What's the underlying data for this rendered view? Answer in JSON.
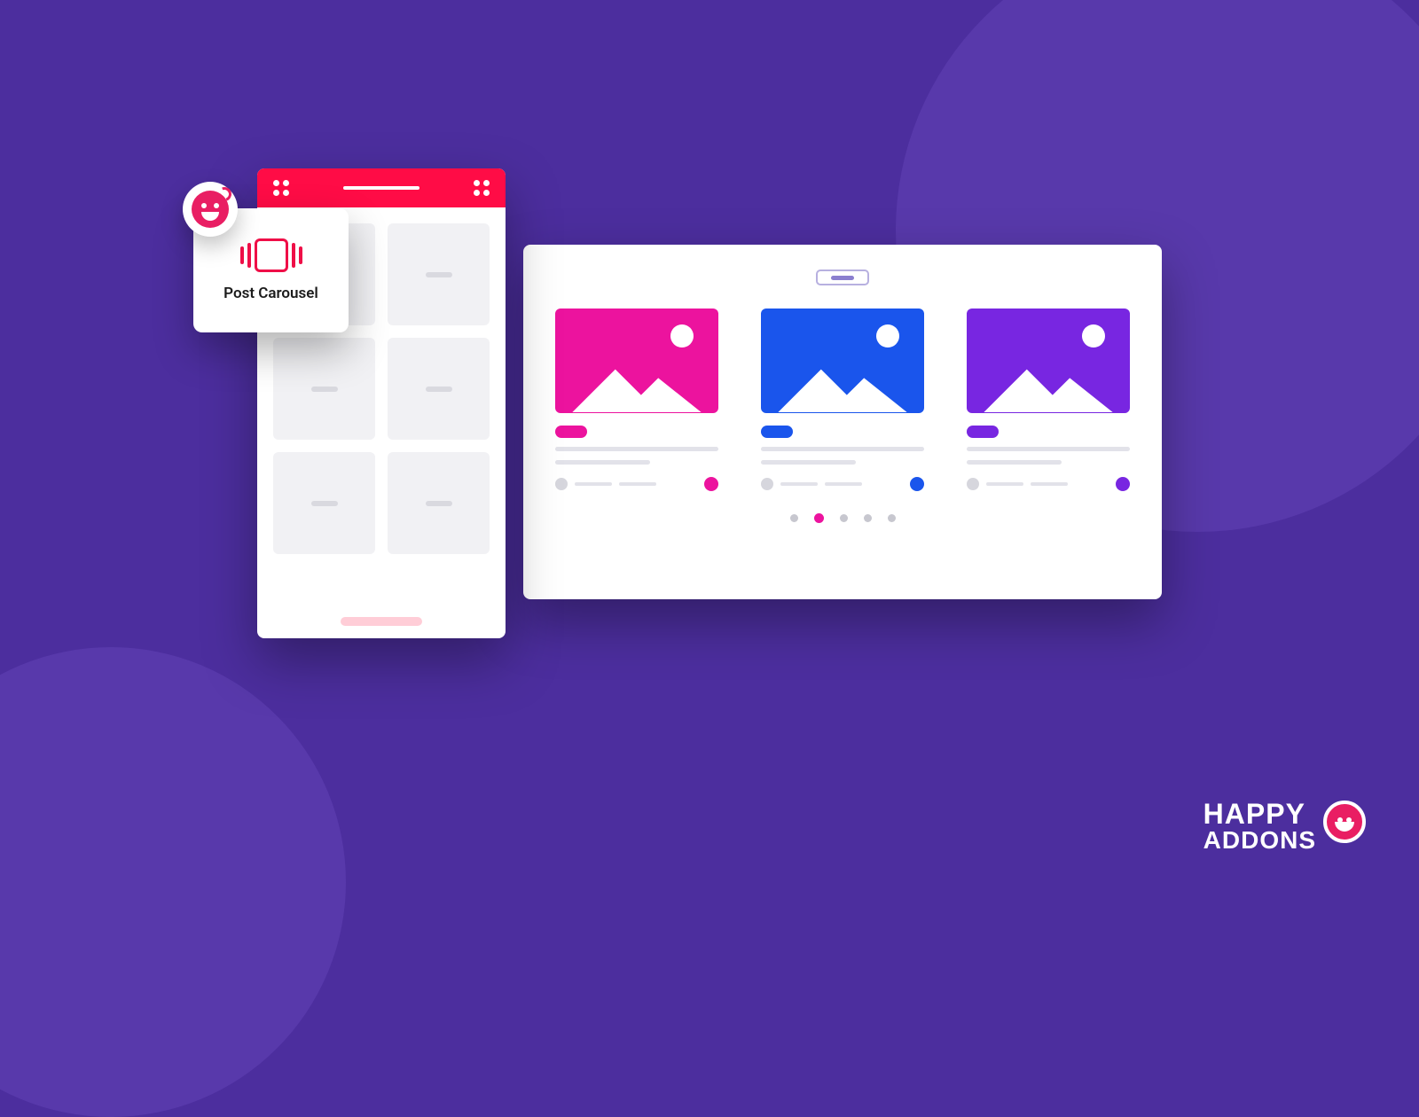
{
  "widget": {
    "label": "Post Carousel"
  },
  "brand": {
    "line1": "HAPPY",
    "line2": "ADDONS"
  },
  "carousel": {
    "cards": [
      {
        "accent": "#ec139e"
      },
      {
        "accent": "#1a55ec"
      },
      {
        "accent": "#7826e1"
      }
    ],
    "active_dot_index": 1,
    "dot_count": 5
  },
  "colors": {
    "background": "#4c2e9e",
    "panel_bar": "#ff0c46",
    "brand_pink": "#e91e63"
  }
}
